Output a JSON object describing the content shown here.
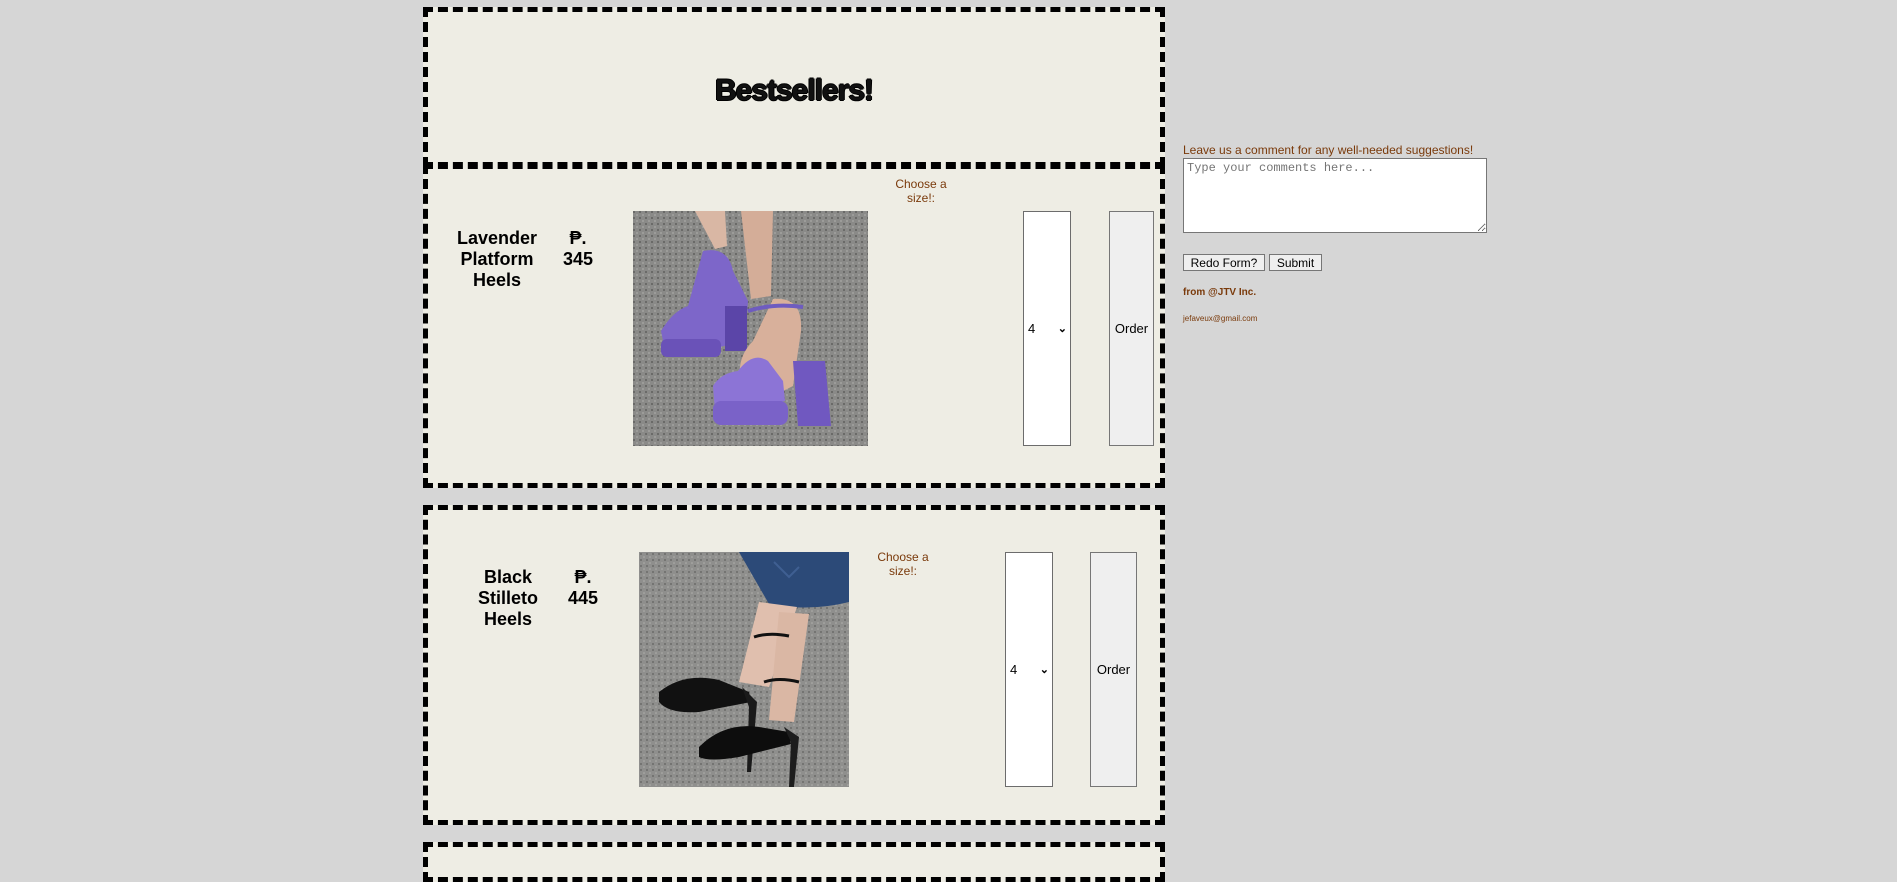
{
  "header": {
    "title": "Bestsellers!"
  },
  "products": [
    {
      "name": "Lavender Platform Heels",
      "price": "₱. 345",
      "size_label": "Choose a size!:",
      "selected_size": "4",
      "order_label": "Order"
    },
    {
      "name": "Black Stilleto Heels",
      "price": "₱. 445",
      "size_label": "Choose a size!:",
      "selected_size": "4",
      "order_label": "Order"
    }
  ],
  "comments": {
    "label": "Leave us a comment for any well-needed suggestions!",
    "placeholder": "Type your comments here...",
    "redo_label": "Redo Form?",
    "submit_label": "Submit"
  },
  "footer": {
    "from": "from @JTV Inc.",
    "email": "jefaveux@gmail.com"
  },
  "colors": {
    "page_bg": "#d6d6d6",
    "panel_bg": "#eeede4",
    "accent_text": "#7a3a0b"
  }
}
